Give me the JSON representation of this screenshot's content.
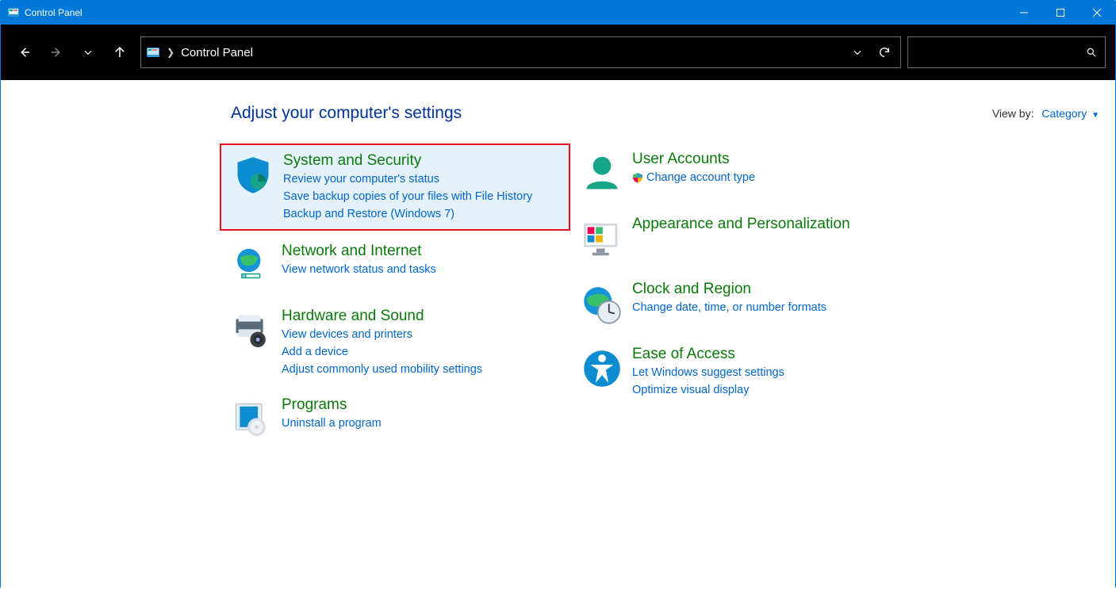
{
  "titlebar": {
    "title": "Control Panel"
  },
  "address": {
    "crumb": "Control Panel"
  },
  "header": {
    "heading": "Adjust your computer's settings",
    "view_by_label": "View by:",
    "view_by_value": "Category"
  },
  "left": {
    "system_security": {
      "title": "System and Security",
      "links": [
        "Review your computer's status",
        "Save backup copies of your files with File History",
        "Backup and Restore (Windows 7)"
      ]
    },
    "network": {
      "title": "Network and Internet",
      "links": [
        "View network status and tasks"
      ]
    },
    "hardware": {
      "title": "Hardware and Sound",
      "links": [
        "View devices and printers",
        "Add a device",
        "Adjust commonly used mobility settings"
      ]
    },
    "programs": {
      "title": "Programs",
      "links": [
        "Uninstall a program"
      ]
    }
  },
  "right": {
    "user_accounts": {
      "title": "User Accounts",
      "links": [
        "Change account type"
      ]
    },
    "appearance": {
      "title": "Appearance and Personalization",
      "links": []
    },
    "clock": {
      "title": "Clock and Region",
      "links": [
        "Change date, time, or number formats"
      ]
    },
    "ease": {
      "title": "Ease of Access",
      "links": [
        "Let Windows suggest settings",
        "Optimize visual display"
      ]
    }
  }
}
